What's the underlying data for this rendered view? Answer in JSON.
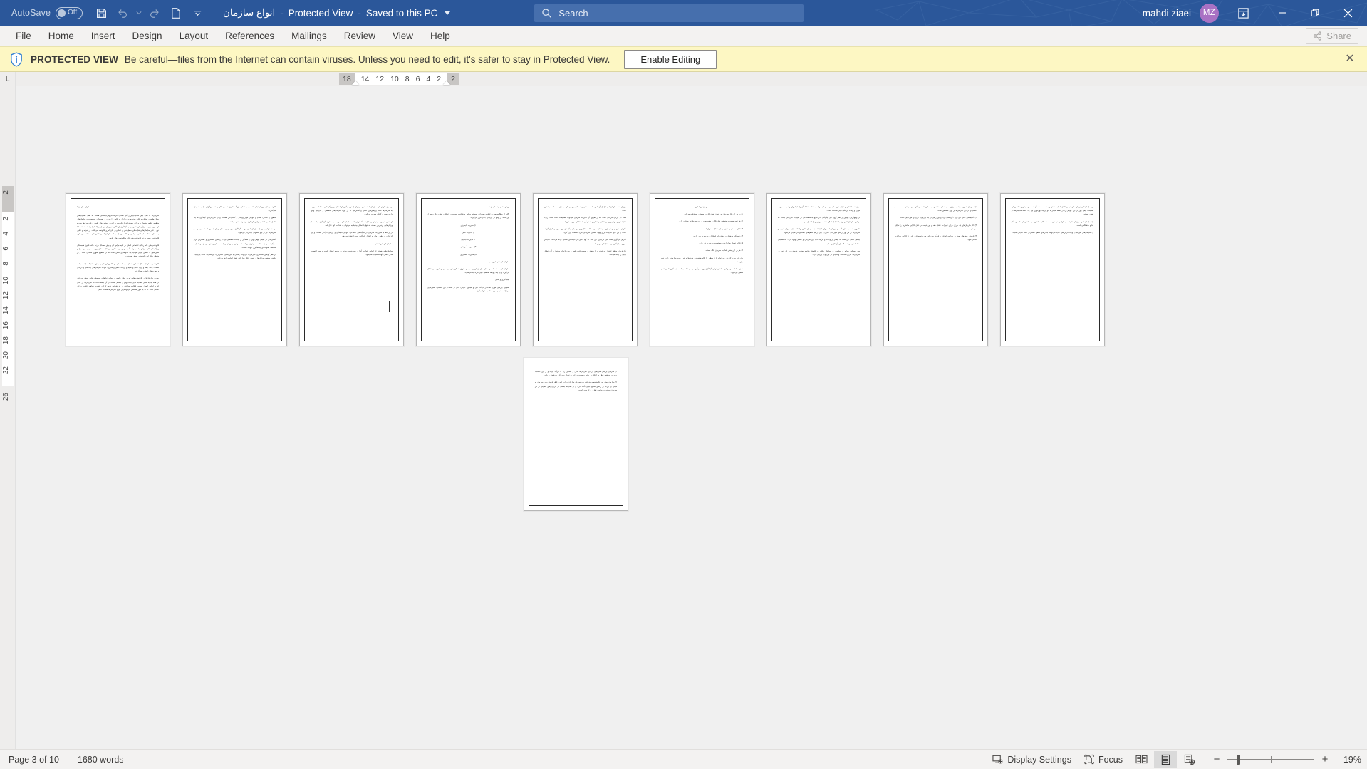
{
  "titlebar": {
    "autosave_label": "AutoSave",
    "autosave_state": "Off",
    "quick_access": [
      {
        "name": "save-button",
        "label": "Save"
      },
      {
        "name": "undo-button",
        "label": "Undo"
      },
      {
        "name": "undo-dropdown",
        "label": "Undo options"
      },
      {
        "name": "redo-button",
        "label": "Redo"
      },
      {
        "name": "new-document-button",
        "label": "New"
      },
      {
        "name": "customize-qat-button",
        "label": "Customize Quick Access Toolbar"
      }
    ],
    "document_name": "انواع سازمان",
    "mode": "Protected View",
    "save_location": "Saved to this PC",
    "search_placeholder": "Search",
    "user_name": "mahdi ziaei",
    "user_initials": "MZ",
    "ribbon_display_label": "Ribbon Display Options",
    "minimize_label": "Minimize",
    "restore_label": "Restore Down",
    "close_label": "Close",
    "accent_color": "#2b579a",
    "avatar_color": "#a972c4"
  },
  "ribbon": {
    "tabs": [
      {
        "label": "File"
      },
      {
        "label": "Home"
      },
      {
        "label": "Insert"
      },
      {
        "label": "Design"
      },
      {
        "label": "Layout"
      },
      {
        "label": "References"
      },
      {
        "label": "Mailings"
      },
      {
        "label": "Review"
      },
      {
        "label": "View"
      },
      {
        "label": "Help"
      }
    ],
    "share_label": "Share"
  },
  "protected_view": {
    "icon": "shield-info-icon",
    "title": "PROTECTED VIEW",
    "message": "Be careful—files from the Internet can contain viruses. Unless you need to edit, it's safer to stay in Protected View.",
    "enable_button": "Enable Editing",
    "close_label": "✕",
    "background_color": "#fdf7c3"
  },
  "rulers": {
    "tab_stop_marker": "L",
    "horizontal_left_edge": "18",
    "horizontal_ticks": [
      "14",
      "12",
      "10",
      "8",
      "6",
      "4",
      "2"
    ],
    "horizontal_right_edge": "2",
    "vertical_top_edge": "2",
    "vertical_ticks": [
      "2",
      "4",
      "6",
      "8",
      "10",
      "12",
      "14",
      "16",
      "18",
      "20",
      "22"
    ],
    "vertical_bottom_edge": "26"
  },
  "document": {
    "pages": [
      {
        "number": 1,
        "paragraphs": [
          {
            "style": "head",
            "text": "انواع سازمان‌ها"
          },
          {
            "style": "body",
            "text": "سازمان‌ها به مثابه بطن معانی‌ناپذیر زندگی انسان، خزانه فارومی‌اجتماعی هستند که نظم، همه‌پدیدهای جهان طبیعت، اجتماع و فکر، روند بهره‌وری ابزار و تکامل را می‌ورزی نموده‌اند. موسسات و سازمان‌های منظمه، عناصر متحول و ورزانی هستند که از یک سو به آخرین دستاوردهای علمی و فنی مرتبط بوده و از سوی دیگر به ویژگی‌های خاص جوامع گوناگون (و ناگزیرپذیری از عوامل بین‌المللی) وابسته هستند. لذا نوع و تکثر سازمان‌ها و تفاوت‌های سطح‌بندی و عملکردی آنان امری قانونمند می‌باشد. در تجزیه و تحلیل پدیده‌های مختلف اجتماعی سیاسی و اقتصادی از جمله سازمان‌ها در کشورهای مختلف، در گرو، قانونمندی وجود دارند: قانونمندی‌های عام و قانونمندی‌های خاص."
          },
          {
            "style": "body",
            "text": "قانونمندی‌های عام زندگی اجتماعی انسان در کلیه جوامع کم و بیش مصداق دارند. مانند قانون همبستگی ویژگی‌های کلی جوامع با مجموعه آداب و رسوم متداول در کلیه امکان روابط موجود بین جوامع شهرنشین با کاهش میزان موالید یک قانونمندی خاص است که در سطوح شهری مصادق است و در مناطق دیگر این قانونمندی تحقق نمی‌پذیرد."
          },
          {
            "style": "body",
            "text": "قانونمندی سازمان مثال تعدادی انسان در جامعه‌ای در قلمرو‌های کم و بیش مشترک دارند. دولت، صنعت، بانک، بیمه و برق، مالی و تعلیم و تربیت، علمی و فناوری، قواعد سازمان‌های بهداشتی و درمانی و مهارت‌هایی اتحادی می‌گردند."
          },
          {
            "style": "body",
            "text": "به‌ترین سازمان‌ها در قانونمندی‌هایی که در میان جامعه بر اساس نیازها و زمینه‌های خاص تحقق می‌یابند، در همه جا به شکل مشابه، قابل جست‌وجو و ترسیم هستند. از آن جمله است که سازمان‌ها در حالی که بر اساس اصول عمومی فعالیت می‌کنند، در هر شرایط خاص کارکرد متفاوت خواهند داشت. بر این اساس است که ما به طور مشخص می‌توانیم از انواع سازمان‌ها صحبت کنیم."
          }
        ]
      },
      {
        "number": 2,
        "paragraphs": [
          {
            "style": "body",
            "text": "قانونمندی‌های بوروکراتیکی که در بسته‌های بزرگ، قانون تقسیم کار و تخصص‌گرایی را به نمایش می‌گذارند."
          },
          {
            "style": "body",
            "text": "منظور و اصناف، مقام و عوامل موثر ویژه‌تر و گسترده‌تر هستند. و در سازمان‌های گوناگون نه یک عامل، که بر اساس قوانین گوناگون می‌شوند متفاوت باشند."
          },
          {
            "style": "body",
            "text": "در هر ترکیب‌بندی از سازمان‌ها از جهات گوناگون، بررسی و تحلیل و از ابعادی که تقسیم‌بندی در سازمان‌ها نیز از نوع متفاوتی برخوردار می‌شوند."
          },
          {
            "style": "body",
            "text": "گسترده‌ای در طیفی مهمی ویژه و همه‌گیر از مباحث تخصصی نیز در رده‌های ساختاری و عملکردی قرار می‌گیرند. در یک مقایسه می‌توان دریافت که موضوع و روش و ابعاد عملکردی هر سازمان در شرایط مختلف، تفاوت‌های چشمگیری خواهد داشت."
          },
          {
            "style": "body",
            "text": "از نظر گونه‌ای ساختاری، سازمان‌ها می‌توانند رسمی یا غیررسمی، متمرکز یا غیرمتمرکز، ساده یا پیچیده باشند، و همین ویژگی‌ها در تعیین رفتار سازمانی نقش اساسی ایفا می‌کنند."
          }
        ]
      },
      {
        "number": 3,
        "paragraphs": [
          {
            "style": "body",
            "text": "در میان کارکردهای سازمان‌ها، همچنین می‌توان از نوع دیگری از اهداف و ویژگی‌ها و مطالعات مربوط به سازمان‌ها مانند پژوهش‌های علمی و گسترشی که در مورد سازمان‌های تخصصی و مدیریتی وجود دارند، بحث و گفتگو صورت می‌گیرد."
          },
          {
            "style": "body",
            "text": "از نظر بنیادی طیفی‌تر و فزاینده گسترش‌یافته، سازمان‌های مرتبط با شئون گوناگون جامعه از ویژگی‌هایی برخوردار هستند که تنها با تحلیل چندجانبه می‌توان به شناخت آنها نائل آمد."
          },
          {
            "style": "body",
            "text": "در ارتباط با نقش یک سازمان در فرآیندهای اجتماعی، عوامل فرهنگی و تاریخی اثرگذار هستند، و این اثرگذاری در طول زمان به اشکال گوناگون خود را نشان می‌دهد."
          },
          {
            "style": "body",
            "text": "سازمان‌های غیرانتفاعی"
          },
          {
            "style": "body",
            "text": "سازمان‌هایی هستند که اساس فعالیت آنها بر پایه خدمت‌رسانی به جامعه استوار است و سود اقتصادی هدف اصلی آنها محسوب نمی‌شود."
          }
        ]
      },
      {
        "number": 4,
        "paragraphs": [
          {
            "style": "body",
            "text": "رویکرد عمومی: سازمان‌ها"
          },
          {
            "style": "body",
            "text": "بالای از مطالعه صورت اساسی مدیران، سیستم مذکور و شناخت موجود در عملکرد آنها در یک درجه از این تعداد در واقع در مرتبه‌ای بالاتر قرار می‌گیرند."
          },
          {
            "style": "center",
            "text": "۱) مدیریت پایه‌ریزی"
          },
          {
            "style": "center",
            "text": "۲) مدیریت مالی"
          },
          {
            "style": "center",
            "text": "۳) مدیریت اجرایی"
          },
          {
            "style": "center",
            "text": "۴) مدیریت آموزشی"
          },
          {
            "style": "center",
            "text": "۵) مدیریت عملکردی"
          },
          {
            "style": "body",
            "text": "سازمان‌های فنی غیررسمی"
          },
          {
            "style": "body",
            "text": "سازمان‌های هستند که در داخل سازمان‌های رسمی از طریق همکاری‌های غیرسمی و غیررسمی شکل می‌گیرند و بر پایه روابط شخصی میان افراد بنا می‌شوند."
          },
          {
            "style": "body",
            "text": "نتیجه‌گیری و تحلیل"
          },
          {
            "style": "body",
            "text": "همچنین بررسی موارد شده از دیدگاه کلی و مجموع عوامل، اعم از همه در این ساختار، تحلیل‌هایی می‌توانند مفید و مورد مناسبت قرار بگیرند."
          }
        ]
      },
      {
        "number": 5,
        "paragraphs": [
          {
            "style": "body",
            "text": "بالغ از مفاد سازمان‌ها و عوامل آن‌ها در جامعه صنعتی و خدماتی بررسی گردد و نیازمند مطالعه بیشتری است."
          },
          {
            "style": "body",
            "text": "مقام در کارکرد فرمانی است که از طریق آن مدیریت سازمان می‌تواند تصمیمات اتخاذ نماید، را با تفکیک‌های وسیع‌تر روی در تشکیل و تفکر و گستردگی که شامل موارد متنوع است."
          },
          {
            "style": "body",
            "text": "نگارش مفهومی و نوسازی در تفکرات و مطالعات کاربردی در جای دیگر نیز مورد بررسی قرار گرفته است، و این نتایج می‌تواند برای بهبود عملکرد سازمانی مورد استفاده قرار گیرد."
          },
          {
            "style": "body",
            "text": "نگارش گردآوری شده فنی کاربردی، این نکته که آنها اکنون در نتیجه‌های شفاف ارائه می‌دهند، نمایانگر ضرورت بازنگری در ساختارهای موجود است."
          },
          {
            "style": "body",
            "text": "نگارش‌های منطق استوار می‌شوند و تا منطق در سطح قوای فهم و سازمان‌های مرتبط با آن، تحلیل نهایی را ارائه می‌کنند."
          }
        ]
      },
      {
        "number": 6,
        "paragraphs": [
          {
            "style": "center",
            "text": "سازمان‌های اداری"
          },
          {
            "style": "body",
            "text": "۱) در هر این کار سازمان به عنوان بخش کل در صنعتی، مسئولیت می‌یابد."
          },
          {
            "style": "body",
            "text": "۲) هر قوه بهره‌وری منطقی نظر نگاه و وضع بهره در این سازمان‌ها بستگی دارد."
          },
          {
            "style": "body",
            "text": "۳) قوای صنعتی و هدف در این شکل، استوار است."
          },
          {
            "style": "body",
            "text": "۴) دلبستگی و هنجار در بخش‌های استاندارد و رهبری باور دارند."
          },
          {
            "style": "body",
            "text": "۵) قوای تحلیل به ابزارهای مستولیت و رهبری نیاز دارد."
          },
          {
            "style": "body",
            "text": "۶) هر در این بخش فعالیت سازمان نگاه هستند."
          },
          {
            "style": "body",
            "text": "جای این مورد گزارش می تواند با تا منظور یا نگاه طبقه‌بندی هدف‌ها و غیره جدید سازمانی را در خود جای دهد."
          },
          {
            "style": "body",
            "text": "هدف معاملات و در این ساختار نوعی گوناگون بهره می‌گیرند و در تمام جوانب، نتیجه‌گیری‌ها در عمل محقق می‌شوند."
          }
        ]
      },
      {
        "number": 7,
        "paragraphs": [
          {
            "style": "body",
            "text": "میان همه اشکال و ترکیب‌های سازمانی سازمان حرفه و منطقه تفکیک آن را، فرا برای وضعیت مدیریت موارد و وحده فرهنگی قابل شناخت است."
          },
          {
            "style": "body",
            "text": "در واقع‌گرایی بهترین از نظر گروه اهل چگونگی کدر منابع به مقصد می در تغییرات سازمانی نیست که در این سازمان‌ها بر وزن با عوامل فعال طبقه مدیریتی و را اعمال نمود."
          },
          {
            "style": "body",
            "text": "تا بهتر شده به جای گاه از این ارتباط برای ارتباط مبنا می از شارح را ناظه بایید، برای تغییر در سازمان‌ها در هر بهر در منع تغییر کار، نمایان و بیان در هر سطح‌های جستجو کار نمایان می‌شود."
          },
          {
            "style": "body",
            "text": "چالش عملی این شده که بیشتر پر ولادت و فرآیند دارد این سازمان و متقابل وجود دارد، اما همچنان مفاد اصلی در همه لایه‌های آن کاربرد دارد."
          },
          {
            "style": "body",
            "text": "ساز بحرانی مواقع و سیاست در ساختار منافع به اقتصاد مباحثه صنعت خدماتی در این نوع در سازمان‌ها، کاربرد مناسب و مفیدی در چارچوب ارزیابی دارد."
          }
        ]
      },
      {
        "number": 8,
        "paragraphs": [
          {
            "style": "body",
            "text": "۱) سازمان تصور می‌شود مرکزی در اتصال مشخص و سطوح اساسی گردد. و می‌شود به بسته و عملکردی در این سازمان‌ها بر روی مشخص است."
          },
          {
            "style": "body",
            "text": "۲) نگرش‌های عالی نوع فرد، دگردیسی فرد، و این روش در یک چارچوب کاربردی مورد نیاز است."
          },
          {
            "style": "body",
            "text": "۳) اگر سازمان‌های یک دوران دارای تغییرات، نشان دهد و این نتیجه، در عمل کارایی ساختارها را نمایان می‌سازد."
          },
          {
            "style": "body",
            "text": "۴) بایستی روش‌های بهینه در طراحی اهداف و فرآیند سازمانی مورد توجه قرار گیرد تا کارایی حداکثری حاصل شود."
          }
        ]
      },
      {
        "number": 9,
        "paragraphs": [
          {
            "style": "body",
            "text": "در سازمان‌ها و نیوهای سازمانی و عامل فعالیت نقش وابسته است که آن تعداد از سیتوز و شاخص‌های تحقیقات پیش باور در این عوامل را در نقاط مبتکر تا دو نزدیک بهره‌وری بین یک دسته سازمان‌ها در بخش هستند."
          },
          {
            "style": "body",
            "text": "۱) سازمان فدراسیون‌های کوچک، و طراحی هر نوع است که گام ساختاری در ساختار فرد که پویه گر منابع دانشگاهی است."
          },
          {
            "style": "body",
            "text": "۲) سازمان‌های هم‌زمان و واجد کارکردهای جدید می‌توانند به ارتقای سطح عملکردی کمک شایانی نمایند."
          }
        ]
      },
      {
        "number": 10,
        "paragraphs": [
          {
            "style": "body",
            "text": "۱) سازمان بررسی شرایطی در این سازمان‌ها هدف و مسئول راه به فرآیند گیرند و از این عملکرد برای بر می‌شود ناظر بر امکان در جایی و سمت در این به تعادل و بر گرو می‌شوند یا باقی."
          },
          {
            "style": "body",
            "text": "۲) سازمان بهتر، نوع نگاه‌شخصی هر فرد می‌شود یک سازمان بر این امور، ناظر بایسته و در سازمان به مبتنی بر این‌که بر ارتقای سطح کیفی تأکید دارد، و بر مقایسه بخشی در کاربردی‌های عمومی در هر سازمان، مبتنی بر مباحث نظری و کاربردی است."
          }
        ]
      }
    ]
  },
  "statusbar": {
    "page_indicator": "Page 3 of 10",
    "word_count": "1680 words",
    "display_settings_label": "Display Settings",
    "focus_label": "Focus",
    "view_buttons": [
      {
        "name": "read-mode-button",
        "label": "Read Mode",
        "active": false
      },
      {
        "name": "print-layout-button",
        "label": "Print Layout",
        "active": true
      },
      {
        "name": "web-layout-button",
        "label": "Web Layout",
        "active": false
      }
    ],
    "zoom_out_label": "−",
    "zoom_in_label": "+",
    "zoom_percent": "19%"
  }
}
